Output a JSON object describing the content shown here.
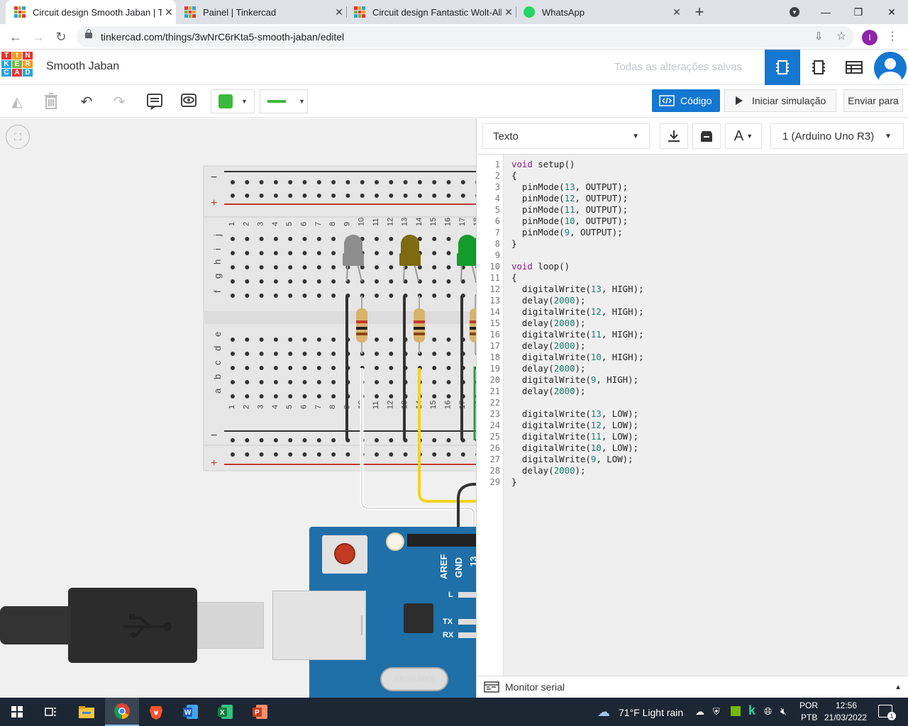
{
  "browser": {
    "tabs": [
      {
        "title": "Circuit design Smooth Jaban | Tinkercad",
        "active": true
      },
      {
        "title": "Painel | Tinkercad",
        "active": false
      },
      {
        "title": "Circuit design Fantastic Wolt-Albanni",
        "active": false
      },
      {
        "title": "WhatsApp",
        "active": false
      }
    ],
    "new_tab_label": "+",
    "url": "tinkercad.com/things/3wNrC6rKta5-smooth-jaban/editel",
    "profile_initial": "I"
  },
  "app": {
    "logo_letters": [
      "T",
      "I",
      "N",
      "K",
      "E",
      "R",
      "C",
      "A",
      "D"
    ],
    "project_name": "Smooth Jaban",
    "save_status": "Todas as alterações salvas",
    "code_button": "Código",
    "simulate_button": "Iniciar simulação",
    "send_button": "Enviar para",
    "shape_color": "#3cb93c",
    "wire_color": "#3cb93c"
  },
  "code_panel": {
    "mode_select": "Texto",
    "device_select": "1 (Arduino Uno R3)",
    "serial_monitor": "Monitor serial",
    "lines": [
      "void setup()",
      "{",
      "  pinMode(13, OUTPUT);",
      "  pinMode(12, OUTPUT);",
      "  pinMode(11, OUTPUT);",
      "  pinMode(10, OUTPUT);",
      "  pinMode(9, OUTPUT);",
      "}",
      "",
      "void loop()",
      "{",
      "  digitalWrite(13, HIGH);",
      "  delay(2000);",
      "  digitalWrite(12, HIGH);",
      "  delay(2000);",
      "  digitalWrite(11, HIGH);",
      "  delay(2000);",
      "  digitalWrite(10, HIGH);",
      "  delay(2000);",
      "  digitalWrite(9, HIGH);",
      "  delay(2000);",
      "",
      "  digitalWrite(13, LOW);",
      "  digitalWrite(12, LOW);",
      "  digitalWrite(11, LOW);",
      "  digitalWrite(10, LOW);",
      "  digitalWrite(9, LOW);",
      "  delay(2000);",
      "}"
    ]
  },
  "breadboard": {
    "row_letters_top": [
      "j",
      "i",
      "h",
      "g",
      "f"
    ],
    "row_letters_bottom": [
      "e",
      "d",
      "c",
      "b",
      "a"
    ],
    "column_numbers": [
      "1",
      "2",
      "3",
      "4",
      "5",
      "6",
      "7",
      "8",
      "9",
      "10",
      "11",
      "12",
      "13",
      "14",
      "15",
      "16",
      "17",
      "18"
    ],
    "rail_minus": "−",
    "rail_plus": "+"
  },
  "arduino": {
    "aref_label": "AREF",
    "gnd_label": "GND",
    "pin13_label": "13",
    "l_label": "L",
    "tx_label": "TX",
    "rx_label": "RX",
    "crystal_label": "SPK16.000G"
  },
  "taskbar": {
    "weather": "71°F  Light rain",
    "lang_top": "POR",
    "lang_bottom": "PTB",
    "time": "12:56",
    "date": "21/03/2022",
    "notifications": "1"
  }
}
